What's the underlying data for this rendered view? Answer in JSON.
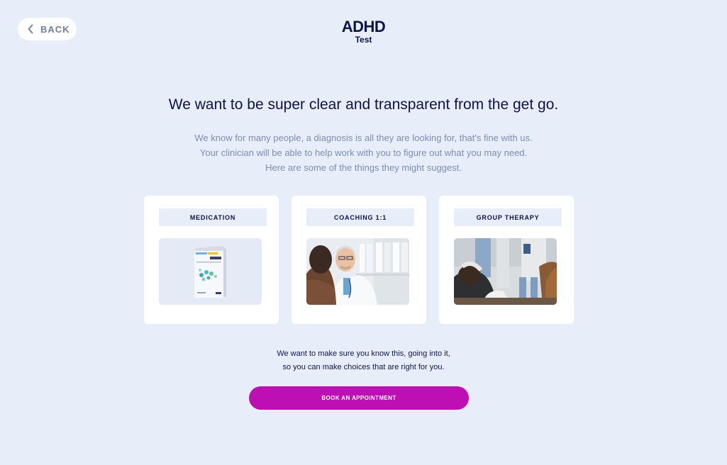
{
  "header": {
    "back_label": "BACK",
    "logo_main": "ADHD",
    "logo_sub": "Test"
  },
  "headline": "We want to be super clear and transparent from the get go.",
  "intro": [
    "We know for many people, a diagnosis is all they are looking for, that's fine with us.",
    "Your clinician will be able to help work with you to figure out what you may need.",
    "Here are some of the things they might suggest."
  ],
  "cards": [
    {
      "label": "MEDICATION",
      "image": "medication-box-photo"
    },
    {
      "label": "COACHING 1:1",
      "image": "doctor-consultation-photo"
    },
    {
      "label": "GROUP THERAPY",
      "image": "group-therapy-photo"
    }
  ],
  "closing": [
    "We want to make sure you know this, going into it,",
    "so you can make choices that are right for you."
  ],
  "cta": {
    "label": "BOOK AN APPOINTMENT"
  },
  "colors": {
    "background": "#e7eef9",
    "primary_text": "#0c1447",
    "muted_text": "#7b8db3",
    "cta": "#be0fb5"
  }
}
